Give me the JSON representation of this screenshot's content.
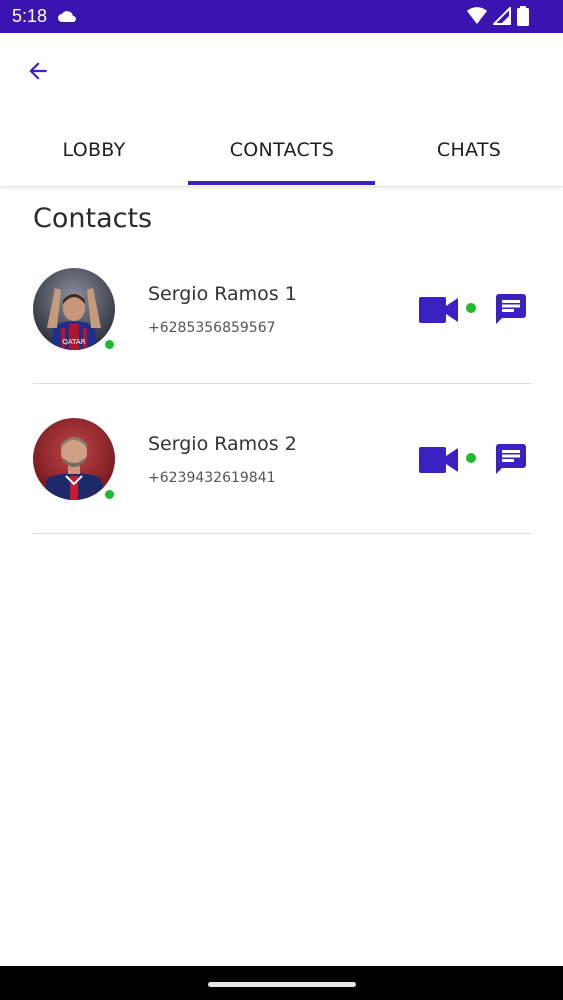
{
  "status_bar": {
    "time": "5:18"
  },
  "tabs": [
    {
      "label": "LOBBY"
    },
    {
      "label": "CONTACTS"
    },
    {
      "label": "CHATS"
    }
  ],
  "active_tab": "CONTACTS",
  "section_title": "Contacts",
  "contacts": [
    {
      "name": "Sergio Ramos 1",
      "phone": "+6285356859567",
      "online": true
    },
    {
      "name": "Sergio Ramos 2",
      "phone": "+6239432619841",
      "online": true
    }
  ],
  "colors": {
    "status_bar": "#3a14b0",
    "accent": "#3a22c2",
    "online": "#1fba2b"
  },
  "icons": [
    "cloud-icon",
    "wifi-icon",
    "signal-icon",
    "battery-icon",
    "back-arrow-icon",
    "video-call-icon",
    "chat-icon"
  ]
}
